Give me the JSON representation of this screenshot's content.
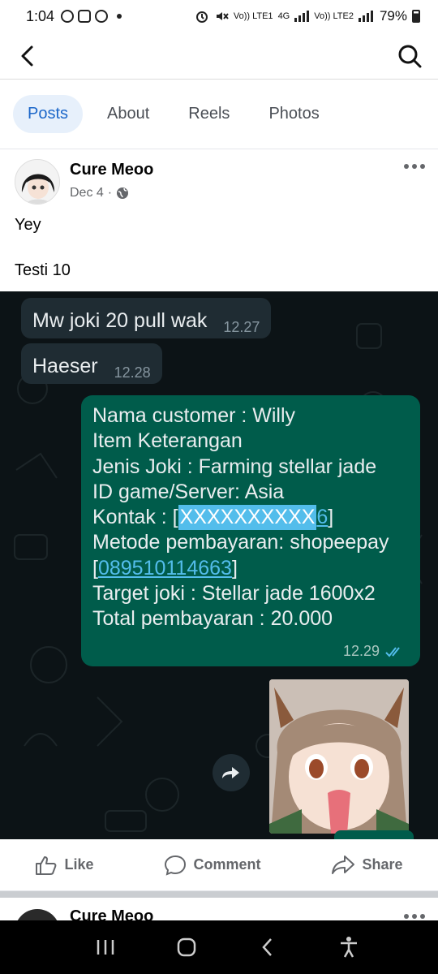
{
  "status_bar": {
    "time": "1:04",
    "net_label_1": "Vo)) LTE1",
    "net_label_2": "4G",
    "net_label_3": "Vo)) LTE2",
    "battery": "79%"
  },
  "tabs": [
    {
      "label": "Posts",
      "active": true
    },
    {
      "label": "About",
      "active": false
    },
    {
      "label": "Reels",
      "active": false
    },
    {
      "label": "Photos",
      "active": false
    }
  ],
  "post": {
    "author": "Cure Meoo",
    "date": "Dec 4",
    "date_separator": "·",
    "text_line1": "Yey",
    "text_line2": "Testi 10",
    "chat": {
      "incoming": [
        {
          "text": "Mw joki 20 pull wak",
          "time": "12.27"
        },
        {
          "text": "Haeser",
          "time": "12.28"
        }
      ],
      "outgoing": {
        "line1": "Nama customer :  Willy",
        "line2": "Item Keterangan",
        "line3": "Jenis Joki : Farming stellar jade",
        "line4": "ID game/Server: Asia",
        "line5_prefix": "Kontak : [",
        "line5_redacted": "XXXXXXXXXX",
        "line5_digit": "6",
        "line5_suffix": "]",
        "line6": "Metode pembayaran: shopeepay",
        "line7_open": "[",
        "line7_phone": "089510114663",
        "line7_close": "]",
        "line8": "Target joki :  Stellar jade 1600x2",
        "line9": "Total pembayaran : 20.000",
        "time": "12.29"
      }
    },
    "actions": {
      "like": "Like",
      "comment": "Comment",
      "share": "Share"
    }
  },
  "next_post": {
    "author": "Cure Meoo"
  },
  "colors": {
    "accent": "#1b66c9",
    "tab_active_bg": "#e7f0fb",
    "chat_bg": "#0c1316",
    "incoming_bubble": "#1f2c33",
    "outgoing_bubble": "#005c4b",
    "link": "#53bdeb"
  },
  "icons": [
    "back-arrow-icon",
    "search-icon",
    "globe-icon",
    "more-icon",
    "forward-icon",
    "read-receipt-icon",
    "like-icon",
    "comment-icon",
    "share-icon",
    "recents-icon",
    "home-icon",
    "back-icon",
    "accessibility-icon"
  ]
}
